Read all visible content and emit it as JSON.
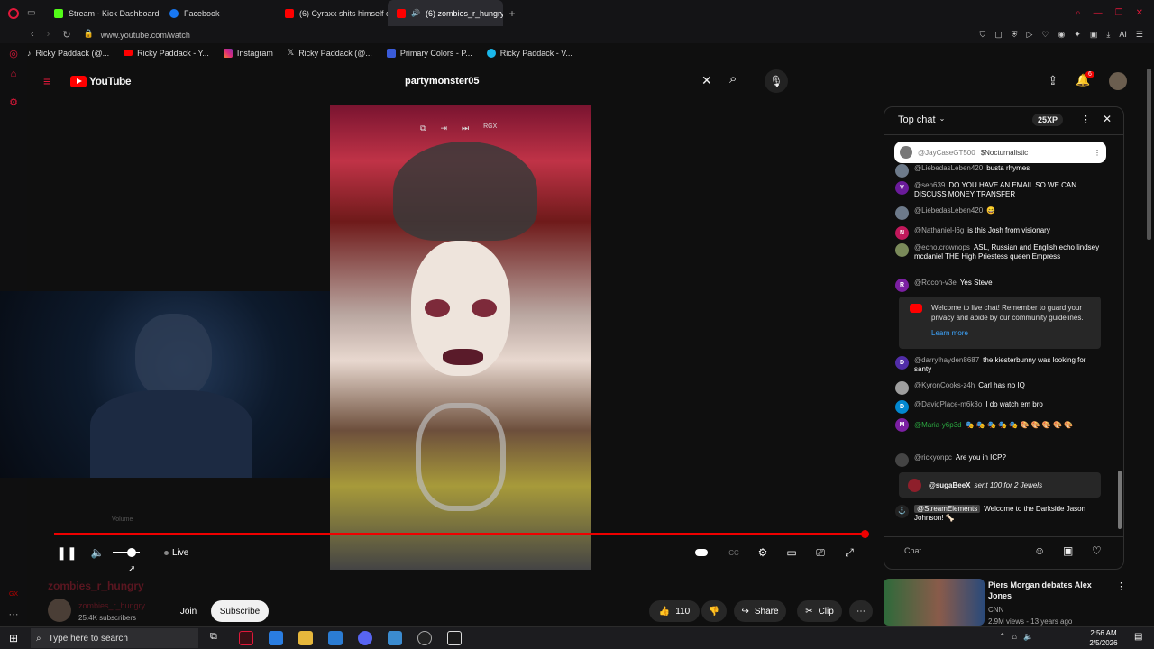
{
  "tabs": [
    {
      "label": "Stream - Kick Dashboard",
      "favicon_color": "#53fc18"
    },
    {
      "label": "Facebook",
      "favicon_color": "#1877f2"
    },
    {
      "label": "(6) Cyraxx shits himself on",
      "favicon_color": "#ff0000"
    },
    {
      "label": "(6) zombies_r_hungry",
      "favicon_color": "#ff0000"
    }
  ],
  "address": "www.youtube.com/watch",
  "bookmarks": [
    {
      "label": "Ricky Paddack (@...",
      "icon": "tiktok-icon"
    },
    {
      "label": "Ricky Paddack - Y...",
      "icon": "youtube-icon"
    },
    {
      "label": "Instagram",
      "icon": "instagram-icon"
    },
    {
      "label": "Ricky Paddack (@...",
      "icon": "x-icon"
    },
    {
      "label": "Primary Colors - P...",
      "icon": "shield-icon"
    },
    {
      "label": "Ricky Paddack - V...",
      "icon": "vimeo-icon"
    }
  ],
  "youtube": {
    "logo_text": "YouTube",
    "search_value": "partymonster05",
    "notification_count": "6"
  },
  "player": {
    "live_label": "Live",
    "volume_tooltip": "Volume",
    "overlay_label": "RGX"
  },
  "channel": {
    "title": "zombies_r_hungry",
    "name": "zombies_r_hungry",
    "subscribers": "25.4K subscribers",
    "join_label": "Join",
    "subscribe_label": "Subscribe"
  },
  "actions": {
    "likes": "110",
    "share_label": "Share",
    "clip_label": "Clip"
  },
  "chat": {
    "title": "Top chat",
    "xp_badge": "25XP",
    "pinned": {
      "user": "@JayCaseGT500",
      "text": "$Nocturnalistic"
    },
    "messages": [
      {
        "user": "@LiebedasLeben420",
        "text": "busta rhymes",
        "initial": "",
        "color": "#6d7a8a"
      },
      {
        "user": "@sen639",
        "text": "DO YOU HAVE AN EMAIL SO WE CAN DISCUSS MONEY TRANSFER",
        "initial": "V",
        "color": "#6a1b9a"
      },
      {
        "user": "@LiebedasLeben420",
        "text": "😄",
        "initial": "",
        "color": "#6d7a8a"
      },
      {
        "user": "@Nathaniel-l6g",
        "text": "is this Josh from visionary",
        "initial": "N",
        "color": "#c2185b"
      },
      {
        "user": "@echo.crownops",
        "text": "ASL, Russian and English echo lindsey mcdaniel THE High Priestess queen Empress",
        "initial": "",
        "color": "#7a8a5a"
      },
      {
        "user": "@Rocon-v3e",
        "text": "Yes Steve",
        "initial": "R",
        "color": "#7b1fa2"
      }
    ],
    "welcome": {
      "text": "Welcome to live chat! Remember to guard your privacy and abide by our community guidelines.",
      "link": "Learn more"
    },
    "messages2": [
      {
        "user": "@darrylhayden8687",
        "text": "the kiesterbunny was looking for santy",
        "initial": "D",
        "color": "#512da8"
      },
      {
        "user": "@KyronCooks-z4h",
        "text": "Carl has no IQ",
        "initial": "",
        "color": "#9e9e9e"
      },
      {
        "user": "@DavidPlace-m6k3o",
        "text": "I do watch em bro",
        "initial": "D",
        "color": "#0288d1"
      },
      {
        "user": "@Maria-y6p3d",
        "text": "🎭 🎭 🎭 🎭 🎭 🎨 🎨 🎨 🎨 🎨",
        "initial": "M",
        "color": "#7b1fa2"
      },
      {
        "user": "@rickyonpc",
        "text": "Are you in ICP?",
        "initial": "",
        "color": "#444"
      }
    ],
    "jewels": {
      "user": "@sugaBeeX",
      "text": "sent 100 for 2 Jewels"
    },
    "streamelements": {
      "user": "@StreamElements",
      "text": "Welcome to the Darkside Jason Johnson! 🦴"
    },
    "input_placeholder": "Chat..."
  },
  "recommendation": {
    "title": "Piers Morgan debates Alex Jones",
    "channel": "CNN",
    "meta": "2.9M views - 13 years ago"
  },
  "taskbar": {
    "search_placeholder": "Type here to search",
    "time": "2:56 AM",
    "date": "2/5/2026"
  },
  "colors": {
    "accent": "#ff0000",
    "brand": "#e0183a"
  }
}
